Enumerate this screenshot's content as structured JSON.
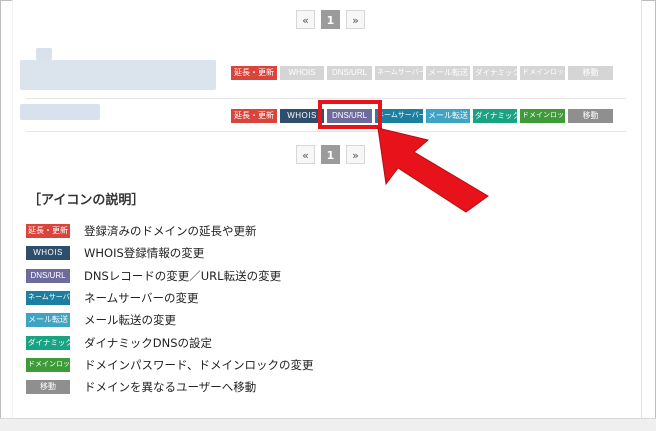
{
  "pagination": {
    "prev": "«",
    "current": "1",
    "next": "»"
  },
  "tags": {
    "renew": "延長・更新",
    "whois": "WHOIS",
    "dns": "DNS/URL",
    "nameserver": "ネームサーバー",
    "mail": "メール転送",
    "dynamic": "ダイナミック",
    "domainlock": "ドメインロック",
    "move": "移動"
  },
  "legend": {
    "title": "［アイコンの説明］",
    "items": [
      {
        "tag": "延長・更新",
        "text": "登録済みのドメインの延長や更新"
      },
      {
        "tag": "WHOIS",
        "text": "WHOIS登録情報の変更"
      },
      {
        "tag": "DNS/URL",
        "text": "DNSレコードの変更／URL転送の変更"
      },
      {
        "tag": "ネームサーバー",
        "text": "ネームサーバーの変更"
      },
      {
        "tag": "メール転送",
        "text": "メール転送の変更"
      },
      {
        "tag": "ダイナミック",
        "text": "ダイナミックDNSの設定"
      },
      {
        "tag": "ドメインロック",
        "text": "ドメインパスワード、ドメインロックの変更"
      },
      {
        "tag": "移動",
        "text": "ドメインを異なるユーザーへ移動"
      }
    ]
  },
  "colors": {
    "renew": "#d9453c",
    "whois": "#2d4f6c",
    "dns": "#6d6b9e",
    "nameserver": "#1d7fa0",
    "mail": "#3fa3c2",
    "dynamic": "#1aa383",
    "domainlock": "#3f9a3a",
    "move": "#8f8f8f",
    "highlight": "#e8121a"
  }
}
